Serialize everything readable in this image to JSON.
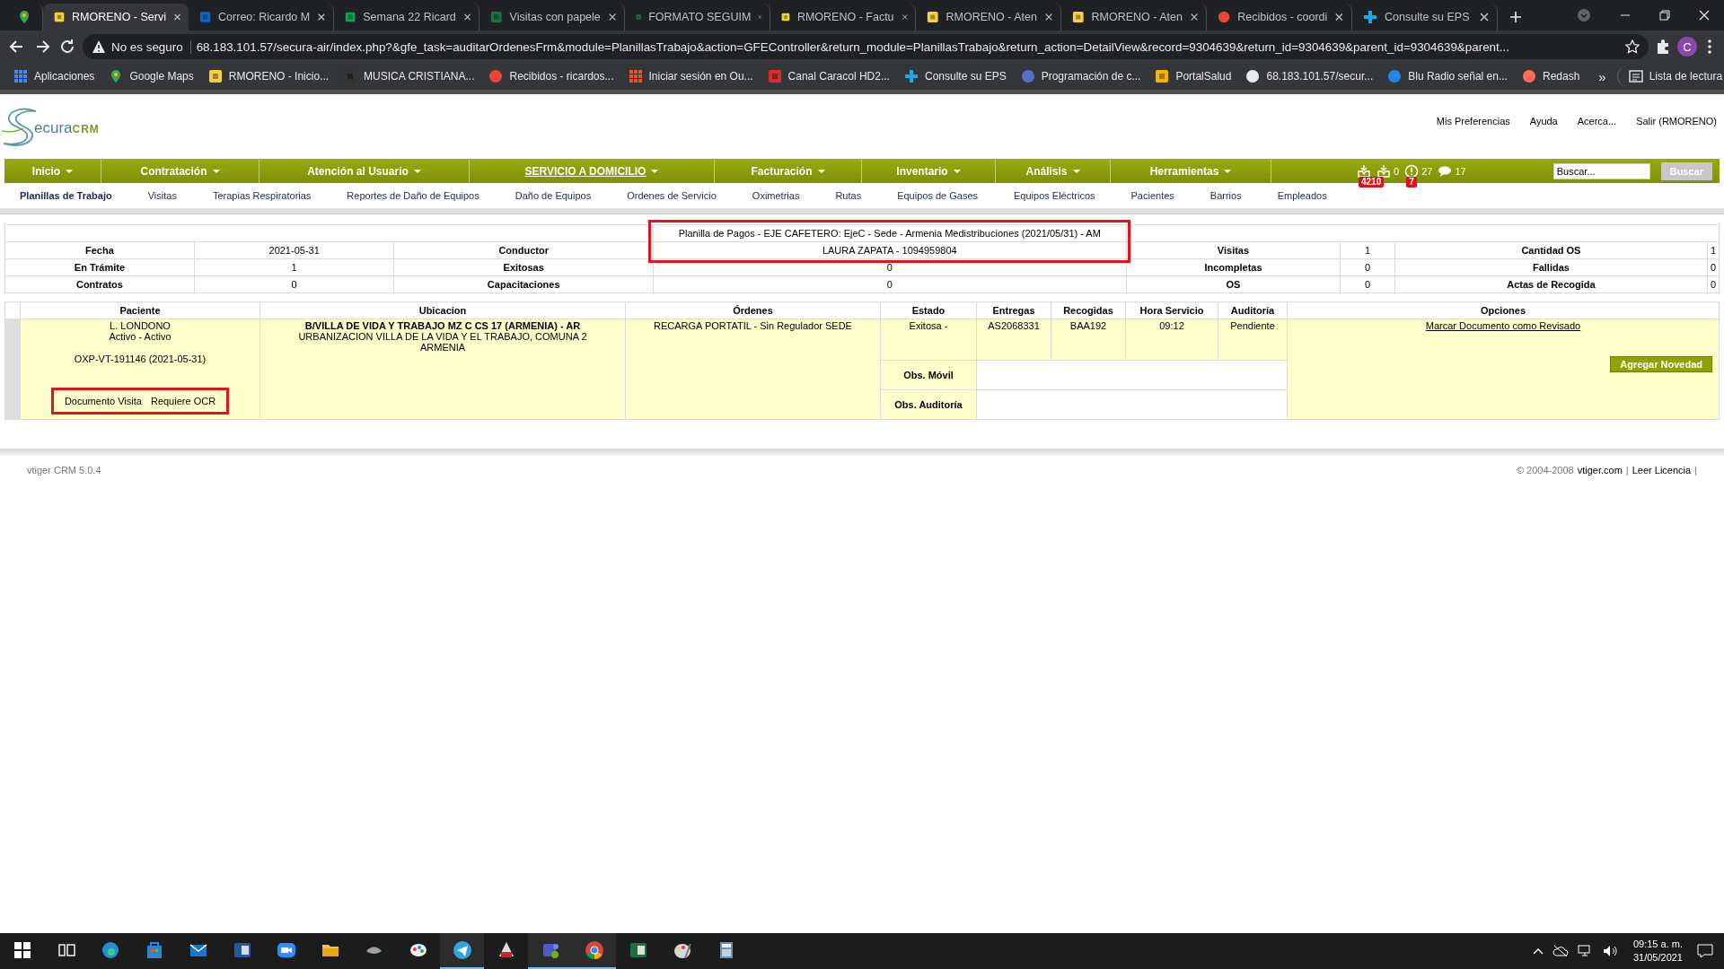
{
  "browser": {
    "tabs": [
      {
        "selected": false,
        "kind": "maps"
      },
      {
        "title": "RMORENO - Servi",
        "selected": true,
        "kind": "rm"
      },
      {
        "title": "Correo: Ricardo M",
        "selected": false,
        "kind": "outlook"
      },
      {
        "title": "Semana 22 Ricard",
        "selected": false,
        "kind": "sheets"
      },
      {
        "title": "Visitas con papele",
        "selected": false,
        "kind": "excel"
      },
      {
        "title": "FORMATO SEGUIM",
        "selected": false,
        "kind": "excel"
      },
      {
        "title": "RMORENO - Factu",
        "selected": false,
        "kind": "rm"
      },
      {
        "title": "RMORENO - Aten",
        "selected": false,
        "kind": "rm"
      },
      {
        "title": "RMORENO - Aten",
        "selected": false,
        "kind": "rm"
      },
      {
        "title": "Recibidos - coordi",
        "selected": false,
        "kind": "gmail"
      },
      {
        "title": "Consulte su EPS",
        "selected": false,
        "kind": "health"
      }
    ],
    "security": "No es seguro",
    "url": "68.183.101.57/secura-air/index.php?&gfe_task=auditarOrdenesFrm&module=PlanillasTrabajo&action=GFEController&return_module=PlanillasTrabajo&return_action=DetailView&record=9304639&return_id=9304639&parent_id=9304639&parent...",
    "profile_initial": "C",
    "bookmarks": [
      {
        "kind": "apps",
        "label": "Aplicaciones"
      },
      {
        "kind": "maps",
        "label": "Google Maps"
      },
      {
        "kind": "rm",
        "label": "RMORENO - Inicio..."
      },
      {
        "kind": "music",
        "label": "MUSICA CRISTIANA..."
      },
      {
        "kind": "gmail",
        "label": "Recibidos - ricardos..."
      },
      {
        "kind": "microsoft",
        "label": "Iniciar sesión en Ou..."
      },
      {
        "kind": "caracol",
        "label": "Canal Caracol HD2..."
      },
      {
        "kind": "health",
        "label": "Consulte su EPS"
      },
      {
        "kind": "prog",
        "label": "Programación de c..."
      },
      {
        "kind": "portal",
        "label": "PortalSalud"
      },
      {
        "kind": "globe",
        "label": "68.183.101.57/secur..."
      },
      {
        "kind": "radio",
        "label": "Blu Radio señal en..."
      },
      {
        "kind": "redash",
        "label": "Redash"
      }
    ],
    "bookmarks_more": "»",
    "reading_list": "Lista de lectura"
  },
  "app": {
    "logo": {
      "text": "ecura",
      "suffix": "CRM"
    },
    "header_links": [
      "Mis Preferencias",
      "Ayuda",
      "Acerca...",
      "Salir (RMORENO)"
    ],
    "menu": [
      {
        "label": "Inicio",
        "selected": false
      },
      {
        "label": "Contratación",
        "selected": false
      },
      {
        "label": "Atención al Usuario",
        "selected": false
      },
      {
        "label": "SERVICIO A DOMICILIO",
        "selected": true
      },
      {
        "label": "Facturación",
        "selected": false
      },
      {
        "label": "Inventario",
        "selected": false
      },
      {
        "label": "Análisis",
        "selected": false
      },
      {
        "label": "Herramientas",
        "selected": false
      }
    ],
    "notifications": [
      {
        "kind": "inbox",
        "badge": "4210"
      },
      {
        "kind": "inbox",
        "count": "0"
      },
      {
        "kind": "alert",
        "badge": "7",
        "count": "27"
      },
      {
        "kind": "chat",
        "count": "17"
      }
    ],
    "search": {
      "placeholder": "Buscar...",
      "button": "Buscar"
    },
    "submenu": [
      {
        "label": "Planillas de Trabajo",
        "selected": true
      },
      {
        "label": "Visitas",
        "selected": false
      },
      {
        "label": "Terapias Respiratorias",
        "selected": false
      },
      {
        "label": "Reportes de Daño de Equipos",
        "selected": false
      },
      {
        "label": "Daño de Equipos",
        "selected": false
      },
      {
        "label": "Ordenes de Servicio",
        "selected": false
      },
      {
        "label": "Oximetrias",
        "selected": false
      },
      {
        "label": "Rutas",
        "selected": false
      },
      {
        "label": "Equipos de Gases",
        "selected": false
      },
      {
        "label": "Equipos Eléctricos",
        "selected": false
      },
      {
        "label": "Pacientes",
        "selected": false
      },
      {
        "label": "Barrios",
        "selected": false
      },
      {
        "label": "Empleados",
        "selected": false
      }
    ],
    "summary": {
      "title": "Planilla de Pagos - EJE CAFETERO: EjeC - Sede - Armenia Medistribuciones (2021/05/31) - AM",
      "highlighted": true,
      "rows": [
        [
          "Fecha",
          "2021-05-31",
          "Conductor",
          "LAURA ZAPATA - 1094959804",
          "Visitas",
          "1",
          "Cantidad OS",
          "1"
        ],
        [
          "En Trámite",
          "1",
          "Exitosas",
          "0",
          "Incompletas",
          "0",
          "Fallidas",
          "0"
        ],
        [
          "Contratos",
          "0",
          "Capacitaciones",
          "0",
          "OS",
          "0",
          "Actas de Recogida",
          "0"
        ]
      ]
    },
    "detail": {
      "columns": [
        "Paciente",
        "Ubicacion",
        "Órdenes",
        "Estado",
        "Entregas",
        "Recogidas",
        "Hora Servicio",
        "Auditoría",
        "Opciones"
      ],
      "rows": [
        {
          "patient": "L. LONDONO",
          "patient_status": "Activo - Activo",
          "code": "OXP-VT-191146 (2021-05-31)",
          "documents": [
            "Documento Visita",
            "Requiere OCR"
          ],
          "documents_highlighted": true,
          "address": "B/VILLA DE VIDA Y TRABAJO MZ C CS 17 (ARMENIA) - AR",
          "address_detail": "URBANIZACION VILLA DE LA VIDA Y EL TRABAJO, COMUNA 2",
          "city": "ARMENIA",
          "order": "RECARGA PORTATIL - Sin Regulador SEDE",
          "status": "Exitosa -",
          "delivery": "AS2068331",
          "pickup": "BAA192",
          "time": "09:12",
          "audit": "Pendiente",
          "obs_mobile": "Obs. Móvil",
          "obs_audit": "Obs. Auditoría",
          "review_link": "Marcar Documento como Revisado",
          "add_button": "Agregar Novedad"
        }
      ]
    },
    "footer": {
      "version": "vtiger CRM 5.0.4",
      "copyright": "© 2004-2008",
      "site": "vtiger.com",
      "separator": "|",
      "license": "Leer Licencia",
      "end": "|"
    }
  },
  "taskbar": {
    "apps": [
      {
        "kind": "taskview",
        "running": false
      },
      {
        "kind": "edge",
        "running": false
      },
      {
        "kind": "store",
        "running": false
      },
      {
        "kind": "mail",
        "running": false
      },
      {
        "kind": "word",
        "running": false
      },
      {
        "kind": "zoom",
        "running": false
      },
      {
        "kind": "folder",
        "running": false
      },
      {
        "kind": "fish",
        "running": false
      },
      {
        "kind": "paint",
        "running": false
      },
      {
        "kind": "telegram",
        "running": true
      },
      {
        "kind": "app",
        "running": false
      },
      {
        "kind": "teams",
        "running": true
      },
      {
        "kind": "chrome",
        "running": true
      },
      {
        "kind": "excel",
        "running": false
      },
      {
        "kind": "palette",
        "running": false
      },
      {
        "kind": "calculator",
        "running": false
      }
    ],
    "time": "09:15 a. m.",
    "date": "31/05/2021"
  }
}
